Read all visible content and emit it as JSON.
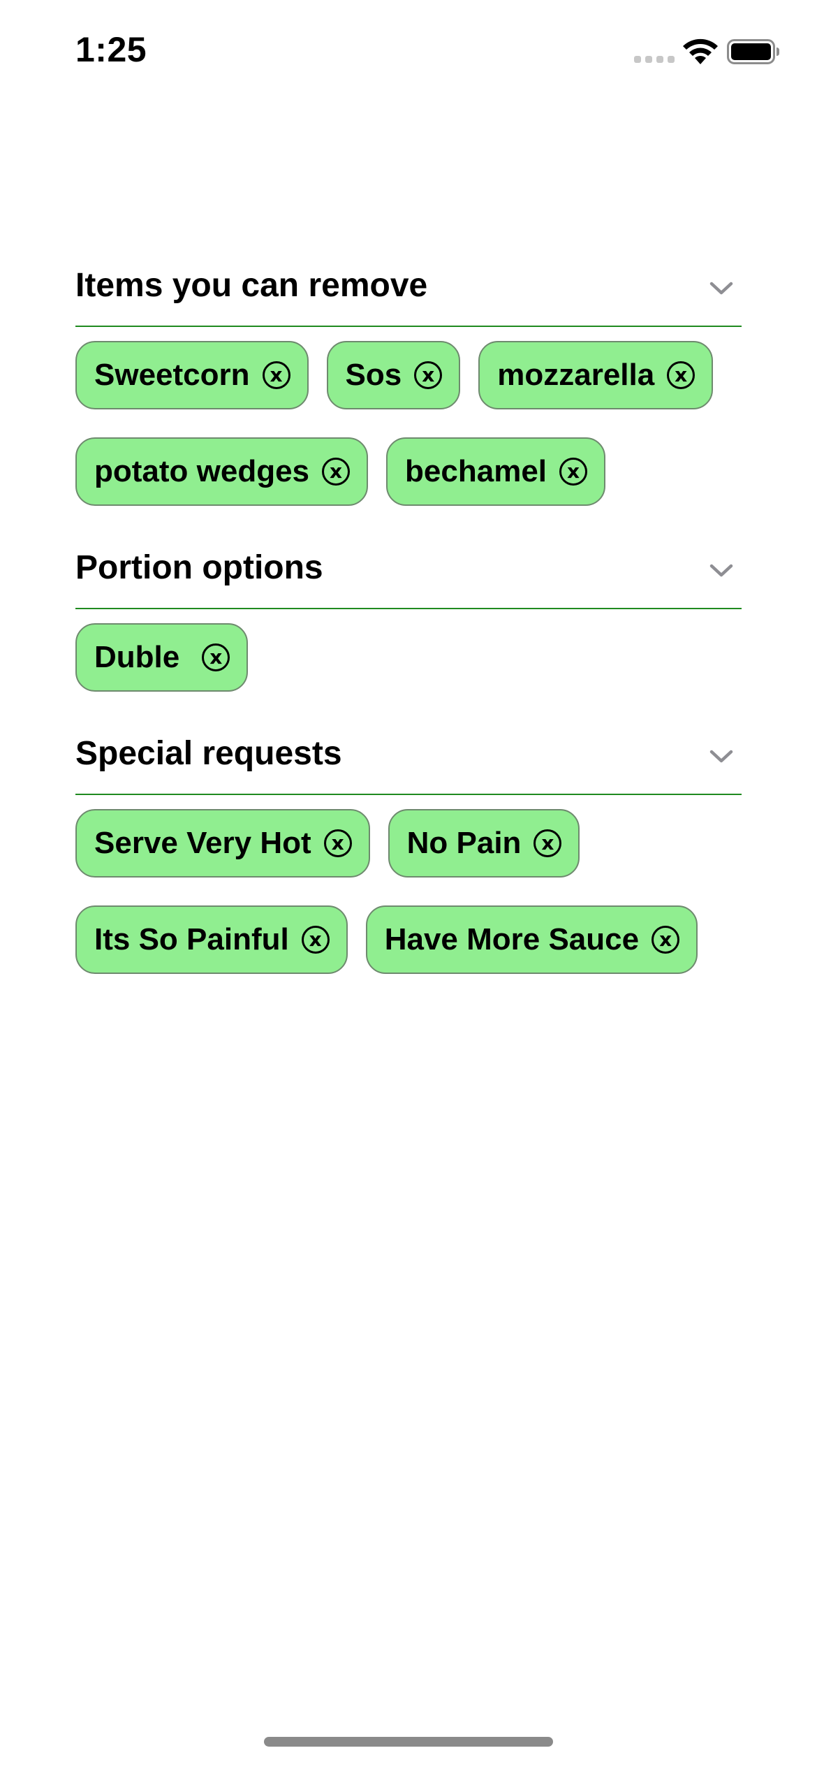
{
  "status_bar": {
    "time": "1:25",
    "icons": [
      "signal-icon",
      "wifi-icon",
      "battery-icon"
    ]
  },
  "sections": [
    {
      "title": "Items you can remove",
      "chips": [
        {
          "label": "Sweetcorn"
        },
        {
          "label": "Sos"
        },
        {
          "label": "mozzarella"
        },
        {
          "label": "potato wedges"
        },
        {
          "label": "bechamel"
        }
      ]
    },
    {
      "title": "Portion options",
      "chips": [
        {
          "label": "Duble"
        }
      ]
    },
    {
      "title": "Special requests",
      "chips": [
        {
          "label": "Serve Very Hot"
        },
        {
          "label": "No Pain"
        },
        {
          "label": "Its So Painful"
        },
        {
          "label": "Have More Sauce"
        }
      ]
    }
  ],
  "colors": {
    "chip_background": "#90ee90",
    "divider": "#1f8a1f",
    "chevron": "#8e8e93"
  }
}
